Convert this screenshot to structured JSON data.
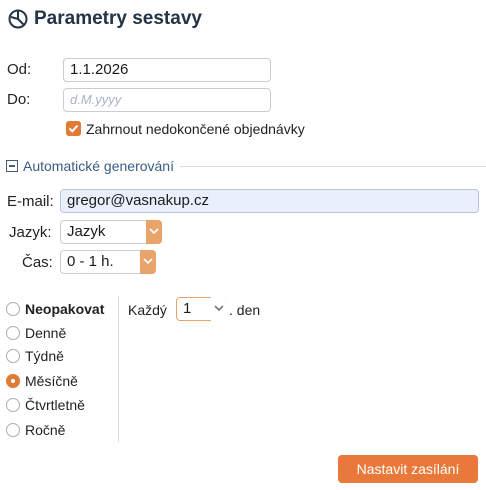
{
  "header": {
    "title": "Parametry sestavy",
    "icon": "chart-pie-icon"
  },
  "date_range": {
    "from_label": "Od:",
    "from_value": "1.1.2026",
    "to_label": "Do:",
    "to_placeholder": "d.M.yyyy",
    "include_unfinished_label": "Zahrnout nedokončené objednávky",
    "include_unfinished_checked": true
  },
  "auto_generation": {
    "section_label": "Automatické generování",
    "email_label": "E-mail:",
    "email_value": "gregor@vasnakup.cz",
    "language_label": "Jazyk:",
    "language_value": "Jazyk",
    "time_label": "Čas:",
    "time_value": "0 - 1 h.",
    "frequency_options": [
      {
        "label": "Neopakovat",
        "checked": false
      },
      {
        "label": "Denně",
        "checked": false
      },
      {
        "label": "Týdně",
        "checked": false
      },
      {
        "label": "Měsíčně",
        "checked": true
      },
      {
        "label": "Čtvrtletně",
        "checked": false
      },
      {
        "label": "Ročně",
        "checked": false
      }
    ],
    "every_label": "Každý",
    "every_value": "1",
    "day_label": ". den"
  },
  "actions": {
    "submit_label": "Nastavit zasílání"
  },
  "colors": {
    "accent": "#e9793a",
    "title": "#243447",
    "link": "#3a5c85"
  }
}
